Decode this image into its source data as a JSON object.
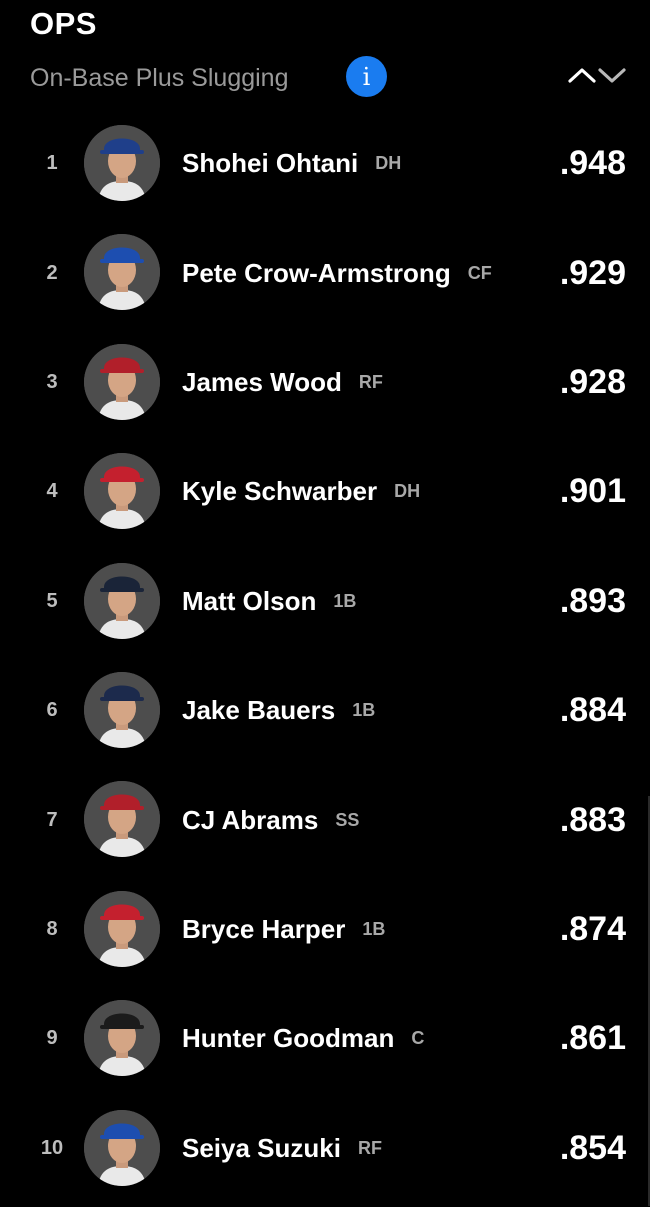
{
  "header": {
    "title": "OPS",
    "subtitle": "On-Base Plus Slugging",
    "info_icon": "info-icon",
    "sort_icon": "sort-up-down-icon"
  },
  "colors": {
    "background": "#000000",
    "accent": "#1a7cf0"
  },
  "players": [
    {
      "rank": "1",
      "name": "Shohei Ohtani",
      "pos": "DH",
      "value": ".948",
      "team_color": "#1f3f8a",
      "logo": "LA"
    },
    {
      "rank": "2",
      "name": "Pete Crow-Armstrong",
      "pos": "CF",
      "value": ".929",
      "team_color": "#1d4eb0",
      "logo": "C"
    },
    {
      "rank": "3",
      "name": "James Wood",
      "pos": "RF",
      "value": ".928",
      "team_color": "#b11f2a",
      "logo": "W"
    },
    {
      "rank": "4",
      "name": "Kyle Schwarber",
      "pos": "DH",
      "value": ".901",
      "team_color": "#c4202e",
      "logo": "P"
    },
    {
      "rank": "5",
      "name": "Matt Olson",
      "pos": "1B",
      "value": ".893",
      "team_color": "#1a2438",
      "logo": "A"
    },
    {
      "rank": "6",
      "name": "Jake Bauers",
      "pos": "1B",
      "value": ".884",
      "team_color": "#1c2a4c",
      "logo": "M"
    },
    {
      "rank": "7",
      "name": "CJ Abrams",
      "pos": "SS",
      "value": ".883",
      "team_color": "#b11f2a",
      "logo": "W"
    },
    {
      "rank": "8",
      "name": "Bryce Harper",
      "pos": "1B",
      "value": ".874",
      "team_color": "#c4202e",
      "logo": "P"
    },
    {
      "rank": "9",
      "name": "Hunter Goodman",
      "pos": "C",
      "value": ".861",
      "team_color": "#1b1b1b",
      "logo": "CR"
    },
    {
      "rank": "10",
      "name": "Seiya Suzuki",
      "pos": "RF",
      "value": ".854",
      "team_color": "#1d4eb0",
      "logo": "C"
    }
  ]
}
